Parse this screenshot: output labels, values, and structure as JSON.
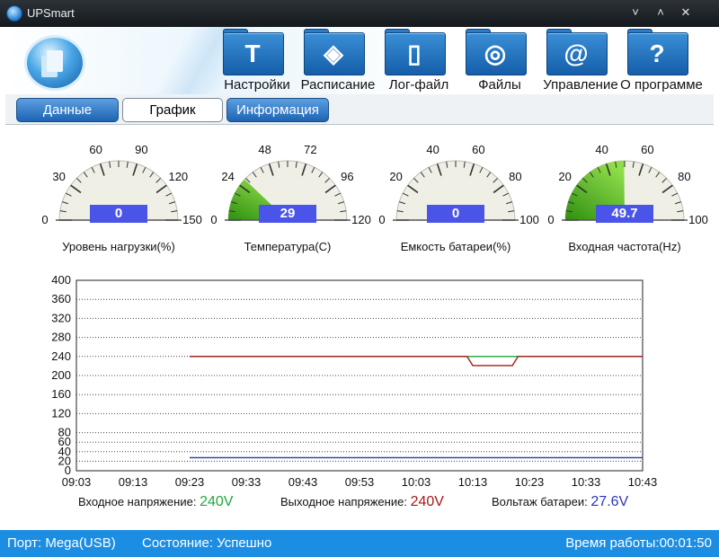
{
  "window": {
    "title": "UPSmart",
    "controls": [
      "˅",
      "˄",
      "✕"
    ]
  },
  "toolbar": [
    {
      "label": "Настройки",
      "icon": "hammer-icon",
      "glyph": "T"
    },
    {
      "label": "Расписание",
      "icon": "schedule-icon",
      "glyph": "◈"
    },
    {
      "label": "Лог-файл",
      "icon": "log-file-icon",
      "glyph": "▯"
    },
    {
      "label": "Файлы",
      "icon": "disc-icon",
      "glyph": "◎"
    },
    {
      "label": "Управление",
      "icon": "at-icon",
      "glyph": "@"
    },
    {
      "label": "О программе",
      "icon": "help-icon",
      "glyph": "?"
    }
  ],
  "tabs": [
    {
      "label": "Данные",
      "active": false
    },
    {
      "label": "График",
      "active": true
    },
    {
      "label": "Информация",
      "active": false
    }
  ],
  "gauges": [
    {
      "label": "Уровень нагрузки(%)",
      "value": "0",
      "max": 150,
      "ticks": [
        "0",
        "30",
        "60",
        "90",
        "120",
        "150"
      ],
      "fill_fraction": 0
    },
    {
      "label": "Температура(C)",
      "value": "29",
      "max": 120,
      "ticks": [
        "0",
        "24",
        "48",
        "72",
        "96",
        "120"
      ],
      "fill_fraction": 0.2417
    },
    {
      "label": "Емкость батареи(%)",
      "value": "0",
      "max": 100,
      "ticks": [
        "0",
        "20",
        "40",
        "60",
        "80",
        "100"
      ],
      "fill_fraction": 0
    },
    {
      "label": "Входная частота(Hz)",
      "value": "49.7",
      "max": 100,
      "ticks": [
        "0",
        "20",
        "40",
        "60",
        "80",
        "100"
      ],
      "fill_fraction": 0.497
    }
  ],
  "chart_data": {
    "type": "line",
    "x": [
      "09:03",
      "09:13",
      "09:23",
      "09:33",
      "09:43",
      "09:53",
      "10:03",
      "10:13",
      "10:23",
      "10:33",
      "10:43"
    ],
    "yticks": [
      0,
      20,
      40,
      60,
      80,
      120,
      160,
      200,
      240,
      280,
      320,
      360,
      400
    ],
    "ylim": [
      0,
      400
    ],
    "grid": true,
    "series": [
      {
        "name": "Входное напряжение:",
        "color": "#22a83a",
        "points": [
          [
            "09:23",
            240
          ],
          [
            "10:43",
            240
          ]
        ]
      },
      {
        "name": "Выходное напряжение:",
        "color": "#a31a1a",
        "points": [
          [
            "09:23",
            240
          ],
          [
            "10:12",
            240
          ],
          [
            "10:13",
            221
          ],
          [
            "10:20",
            221
          ],
          [
            "10:21",
            240
          ],
          [
            "10:43",
            240
          ]
        ]
      },
      {
        "name": "Вольтаж батареи:",
        "color": "#2a36b8",
        "points": [
          [
            "09:23",
            27.6
          ],
          [
            "10:43",
            27.6
          ]
        ]
      }
    ]
  },
  "legend": [
    {
      "label": "Входное напряжение:",
      "value": "240V",
      "color": "#22a83a"
    },
    {
      "label": "Выходное напряжение:",
      "value": "240V",
      "color": "#a31a1a"
    },
    {
      "label": "Вольтаж батареи:",
      "value": "27.6V",
      "color": "#2a36b8"
    }
  ],
  "status": {
    "port": "Порт: Mega(USB)",
    "state": "Состояние: Успешно",
    "uptime": "Время работы:00:01:50"
  }
}
